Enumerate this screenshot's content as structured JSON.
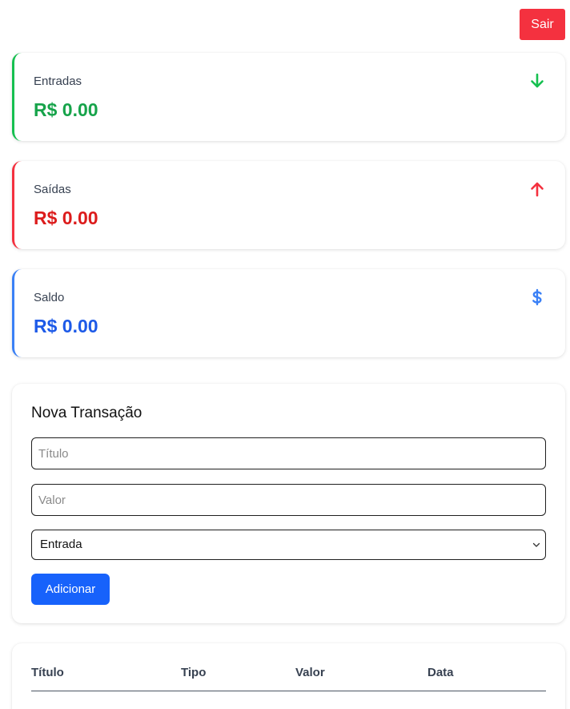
{
  "header": {
    "logout_label": "Sair"
  },
  "summary": {
    "income": {
      "label": "Entradas",
      "value": "R$ 0.00",
      "icon": "arrow-down-icon",
      "color": "#16a34a"
    },
    "expense": {
      "label": "Saídas",
      "value": "R$ 0.00",
      "icon": "arrow-up-icon",
      "color": "#dc1c1c"
    },
    "balance": {
      "label": "Saldo",
      "value": "R$ 0.00",
      "icon": "dollar-icon",
      "color": "#1d5ae8"
    }
  },
  "form": {
    "title": "Nova Transação",
    "title_placeholder": "Título",
    "amount_placeholder": "Valor",
    "type_selected": "Entrada",
    "submit_label": "Adicionar"
  },
  "table": {
    "columns": [
      "Título",
      "Tipo",
      "Valor",
      "Data"
    ],
    "rows": []
  },
  "colors": {
    "income_border": "#16c050",
    "expense_border": "#f4313f",
    "balance_border": "#3a80f6",
    "primary_button": "#1762fb",
    "logout_button": "#f4313f"
  }
}
